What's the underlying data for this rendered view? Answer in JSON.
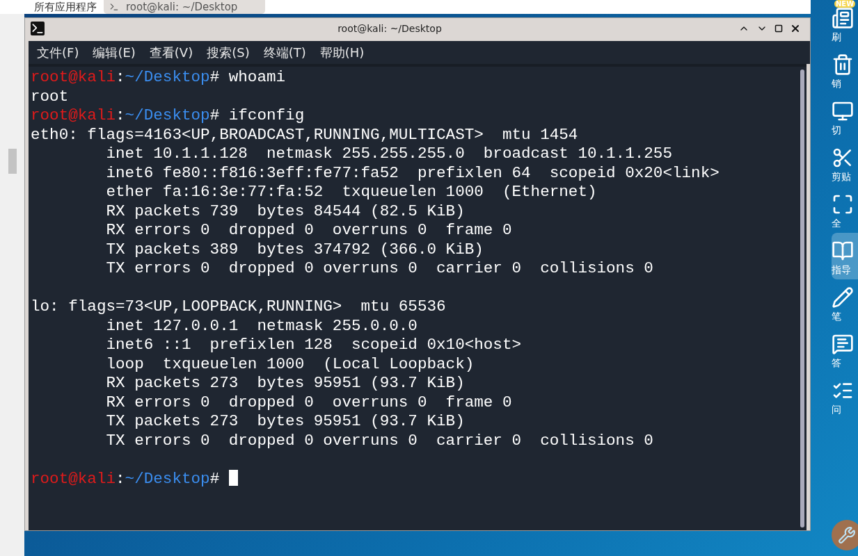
{
  "taskbar": {
    "apps_label": "所有应用程序",
    "window_tab": "root@kali: ~/Desktop"
  },
  "window": {
    "title": "root@kali: ~/Desktop"
  },
  "menu": [
    "文件(F)",
    "编辑(E)",
    "查看(V)",
    "搜索(S)",
    "终端(T)",
    "帮助(H)"
  ],
  "terminal": {
    "lines": [
      {
        "kind": "prompt",
        "user": "root@kali",
        "sep": ":",
        "path": "~/Desktop",
        "mark": "#",
        "command": "whoami"
      },
      {
        "kind": "output",
        "text": "root"
      },
      {
        "kind": "prompt",
        "user": "root@kali",
        "sep": ":",
        "path": "~/Desktop",
        "mark": "#",
        "command": "ifconfig"
      },
      {
        "kind": "output",
        "text": "eth0: flags=4163<UP,BROADCAST,RUNNING,MULTICAST>  mtu 1454"
      },
      {
        "kind": "output",
        "text": "        inet 10.1.1.128  netmask 255.255.255.0  broadcast 10.1.1.255"
      },
      {
        "kind": "output",
        "text": "        inet6 fe80::f816:3eff:fe77:fa52  prefixlen 64  scopeid 0x20<link>"
      },
      {
        "kind": "output",
        "text": "        ether fa:16:3e:77:fa:52  txqueuelen 1000  (Ethernet)"
      },
      {
        "kind": "output",
        "text": "        RX packets 739  bytes 84544 (82.5 KiB)"
      },
      {
        "kind": "output",
        "text": "        RX errors 0  dropped 0  overruns 0  frame 0"
      },
      {
        "kind": "output",
        "text": "        TX packets 389  bytes 374792 (366.0 KiB)"
      },
      {
        "kind": "output",
        "text": "        TX errors 0  dropped 0 overruns 0  carrier 0  collisions 0"
      },
      {
        "kind": "blank"
      },
      {
        "kind": "output",
        "text": "lo: flags=73<UP,LOOPBACK,RUNNING>  mtu 65536"
      },
      {
        "kind": "output",
        "text": "        inet 127.0.0.1  netmask 255.0.0.0"
      },
      {
        "kind": "output",
        "text": "        inet6 ::1  prefixlen 128  scopeid 0x10<host>"
      },
      {
        "kind": "output",
        "text": "        loop  txqueuelen 1000  (Local Loopback)"
      },
      {
        "kind": "output",
        "text": "        RX packets 273  bytes 95951 (93.7 KiB)"
      },
      {
        "kind": "output",
        "text": "        RX errors 0  dropped 0  overruns 0  frame 0"
      },
      {
        "kind": "output",
        "text": "        TX packets 273  bytes 95951 (93.7 KiB)"
      },
      {
        "kind": "output",
        "text": "        TX errors 0  dropped 0 overruns 0  carrier 0  collisions 0"
      },
      {
        "kind": "blank"
      },
      {
        "kind": "prompt",
        "user": "root@kali",
        "sep": ":",
        "path": "~/Desktop",
        "mark": "#",
        "cursor": true
      }
    ]
  },
  "sidebar": {
    "items": [
      {
        "kind": "refresh",
        "label": "刷",
        "selected": false,
        "badge": "NEW"
      },
      {
        "kind": "trash",
        "label": "销",
        "selected": false
      },
      {
        "kind": "monitor",
        "label": "切",
        "selected": false
      },
      {
        "kind": "scissors",
        "label": "剪贴",
        "selected": false
      },
      {
        "kind": "fullscreen",
        "label": "全",
        "selected": false
      },
      {
        "kind": "guide",
        "label": "指导",
        "selected": true
      },
      {
        "kind": "pencil",
        "label": "笔",
        "selected": false
      },
      {
        "kind": "quiz",
        "label": "答",
        "selected": false
      },
      {
        "kind": "qa",
        "label": "问",
        "selected": false
      }
    ]
  }
}
